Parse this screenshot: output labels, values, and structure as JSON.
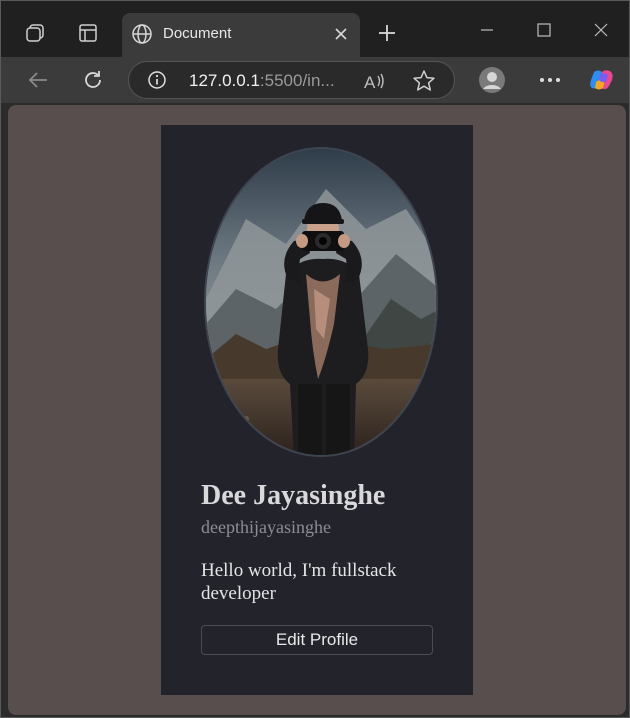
{
  "browser": {
    "tab_title": "Document",
    "url_host": "127.0.0.1",
    "url_rest": ":5500/in..."
  },
  "icons": {
    "workspaces": "workspaces-icon",
    "tab_actions": "tab-actions-icon",
    "globe": "globe-icon",
    "close_tab": "close-icon",
    "new_tab": "plus-icon",
    "minimize": "minimize-icon",
    "maximize": "maximize-icon",
    "close_window": "close-window-icon",
    "back": "back-arrow-icon",
    "refresh": "refresh-icon",
    "site_info": "info-icon",
    "read_aloud": "read-aloud-icon",
    "favorite": "star-icon",
    "profile": "profile-avatar-icon",
    "more": "more-icon",
    "copilot": "copilot-icon"
  },
  "profile": {
    "name": "Dee Jayasinghe",
    "username": "deepthijayasinghe",
    "bio": "Hello world, I'm fullstack developer",
    "edit_label": "Edit Profile"
  },
  "colors": {
    "page_background": "#574e4d",
    "card_background": "#23242b"
  }
}
